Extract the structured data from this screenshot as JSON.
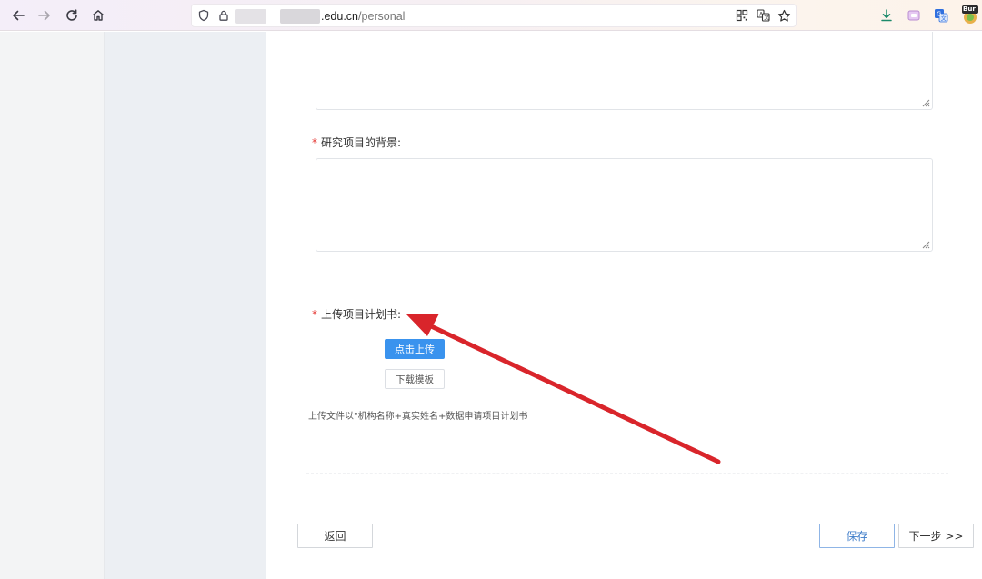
{
  "browser": {
    "url_domain": ".edu.cn",
    "url_path": "/personal",
    "extension_badge": "Bur"
  },
  "form": {
    "required_mark": "*",
    "background_label": "研究项目的背景:",
    "upload_label": "上传项目计划书:",
    "upload_button": "点击上传",
    "template_button": "下载模板",
    "upload_hint": "上传文件以\"机构名称+真实姓名+数据申请项目计划书"
  },
  "footer": {
    "back_button": "返回",
    "save_button": "保存",
    "next_button": "下一步 >>"
  },
  "colors": {
    "primary": "#3a93ee",
    "required": "#e53935",
    "annotation_arrow": "#d9252b"
  },
  "icons": [
    "back-icon",
    "forward-icon",
    "reload-icon",
    "home-icon",
    "shield-icon",
    "lock-icon",
    "qr-code-icon",
    "translate-icon",
    "star-icon",
    "download-icon",
    "extension-icon",
    "translate-extension-icon",
    "profile-badge-icon"
  ]
}
